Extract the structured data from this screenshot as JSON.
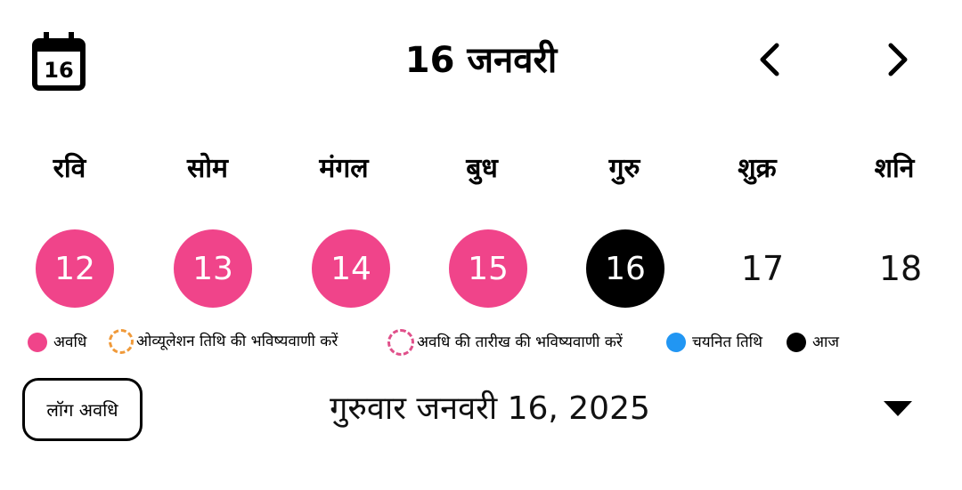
{
  "header": {
    "calendar_icon_day": "16",
    "title": "16 जनवरी"
  },
  "weekdays": [
    "रवि",
    "सोम",
    "मंगल",
    "बुध",
    "गुरु",
    "शुक्र",
    "शनि"
  ],
  "days": [
    {
      "label": "12",
      "state": "period"
    },
    {
      "label": "13",
      "state": "period"
    },
    {
      "label": "14",
      "state": "period"
    },
    {
      "label": "15",
      "state": "period"
    },
    {
      "label": "16",
      "state": "today"
    },
    {
      "label": "17",
      "state": "plain"
    },
    {
      "label": "18",
      "state": "plain"
    }
  ],
  "legend": {
    "period": "अवधि",
    "ovulation_prediction": "ओव्यूलेशन तिथि की भविष्यवाणी करें",
    "period_prediction": "अवधि की तारीख की भविष्यवाणी करें",
    "selected_date": "चयनित तिथि",
    "today": "आज"
  },
  "bottom": {
    "log_button": "लॉग अवधि",
    "selected_date_text": "गुरुवार जनवरी 16, 2025"
  },
  "colors": {
    "period": "#f0448a",
    "ovulation": "#f09a3a",
    "prediction": "#e0508a",
    "selected": "#2196f3",
    "today": "#000000"
  },
  "icons": {
    "calendar": "calendar-icon",
    "prev": "chevron-left-icon",
    "next": "chevron-right-icon",
    "dropdown": "caret-down-icon"
  }
}
